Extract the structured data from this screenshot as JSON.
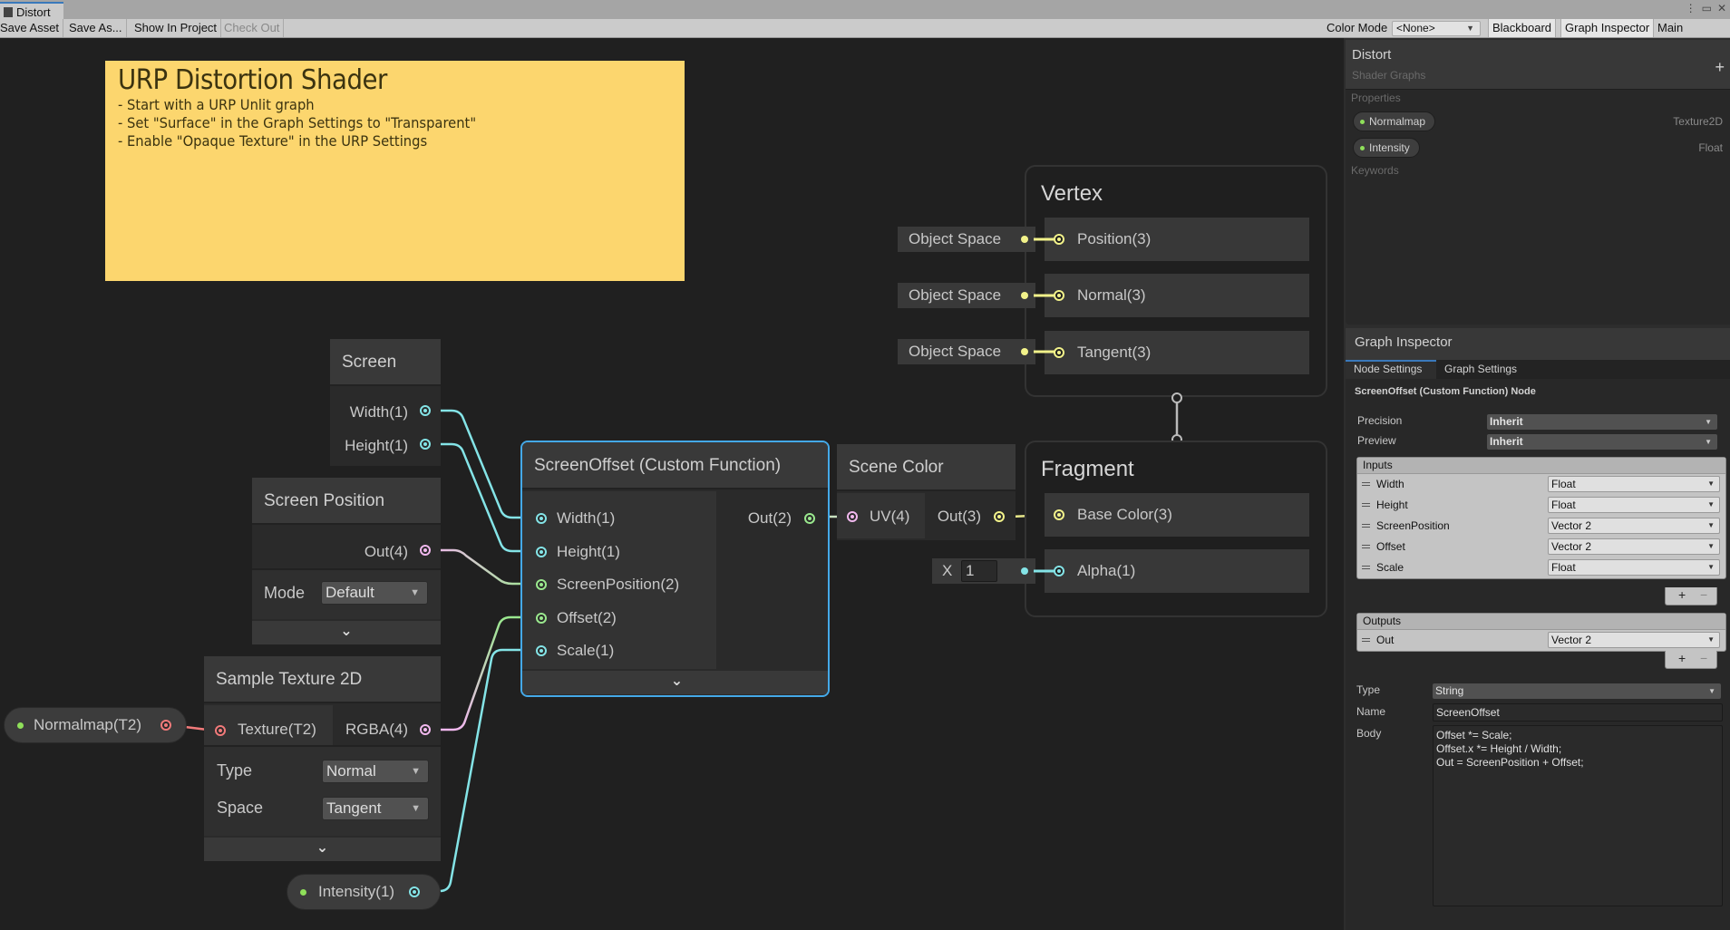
{
  "window": {
    "tab_label": "Distort",
    "controls": [
      "⋮",
      "▭",
      "✕"
    ]
  },
  "toolbar": {
    "save_asset": "Save Asset",
    "save_as": "Save As...",
    "show_in_project": "Show In Project",
    "check_out": "Check Out",
    "color_mode_label": "Color Mode",
    "color_mode_value": "<None>",
    "blackboard": "Blackboard",
    "graph_inspector": "Graph Inspector",
    "main_preview": "Main Preview"
  },
  "sticky_note": {
    "title": "URP Distortion Shader",
    "lines": [
      "- Start with a URP Unlit graph",
      "- Set \"Surface\" in the Graph Settings to \"Transparent\"",
      "- Enable \"Opaque Texture\" in the URP Settings"
    ]
  },
  "nodes": {
    "screen": {
      "title": "Screen",
      "outputs": [
        "Width(1)",
        "Height(1)"
      ]
    },
    "screen_position": {
      "title": "Screen Position",
      "output": "Out(4)",
      "mode_label": "Mode",
      "mode_value": "Default"
    },
    "sample_texture": {
      "title": "Sample Texture 2D",
      "input": "Texture(T2)",
      "output": "RGBA(4)",
      "type_label": "Type",
      "type_value": "Normal",
      "space_label": "Space",
      "space_value": "Tangent"
    },
    "custom_function": {
      "title": "ScreenOffset (Custom Function)",
      "inputs": [
        "Width(1)",
        "Height(1)",
        "ScreenPosition(2)",
        "Offset(2)",
        "Scale(1)"
      ],
      "output": "Out(2)"
    },
    "scene_color": {
      "title": "Scene Color",
      "input": "UV(4)",
      "output": "Out(3)"
    },
    "normalmap_property": "Normalmap(T2)",
    "intensity_property": "Intensity(1)"
  },
  "vertex": {
    "title": "Vertex",
    "blocks": [
      "Position(3)",
      "Normal(3)",
      "Tangent(3)"
    ],
    "inline_inputs": [
      "Object Space",
      "Object Space",
      "Object Space"
    ]
  },
  "fragment": {
    "title": "Fragment",
    "blocks": [
      "Base Color(3)",
      "Alpha(1)"
    ],
    "alpha_label": "X",
    "alpha_value": "1"
  },
  "blackboard": {
    "title": "Distort",
    "subtitle": "Shader Graphs",
    "add_icon": "+",
    "properties_label": "Properties",
    "properties": [
      {
        "name": "Normalmap",
        "type": "Texture2D"
      },
      {
        "name": "Intensity",
        "type": "Float"
      }
    ],
    "keywords_label": "Keywords"
  },
  "inspector": {
    "title": "Graph Inspector",
    "tabs": [
      "Node Settings",
      "Graph Settings"
    ],
    "node_name": "ScreenOffset (Custom Function) Node",
    "precision_label": "Precision",
    "precision_value": "Inherit",
    "preview_label": "Preview",
    "preview_value": "Inherit",
    "inputs_label": "Inputs",
    "inputs": [
      {
        "name": "Width",
        "type": "Float"
      },
      {
        "name": "Height",
        "type": "Float"
      },
      {
        "name": "ScreenPosition",
        "type": "Vector 2"
      },
      {
        "name": "Offset",
        "type": "Vector 2"
      },
      {
        "name": "Scale",
        "type": "Float"
      }
    ],
    "outputs_label": "Outputs",
    "outputs": [
      {
        "name": "Out",
        "type": "Vector 2"
      }
    ],
    "type_label": "Type",
    "type_value": "String",
    "name_label": "Name",
    "name_value": "ScreenOffset",
    "body_label": "Body",
    "body_lines": [
      "Offset *= Scale;",
      "Offset.x *= Height / Width;",
      "Out = ScreenPosition + Offset;"
    ]
  },
  "colors": {
    "float_port": "#84e4e7",
    "vector2_port": "#9ae88e",
    "vector3_port": "#f2f28a",
    "vector4_port": "#f1b8ee",
    "texture_port": "#f17a7a",
    "selection": "#44a9e8",
    "sticky_note": "#fcd66e"
  }
}
